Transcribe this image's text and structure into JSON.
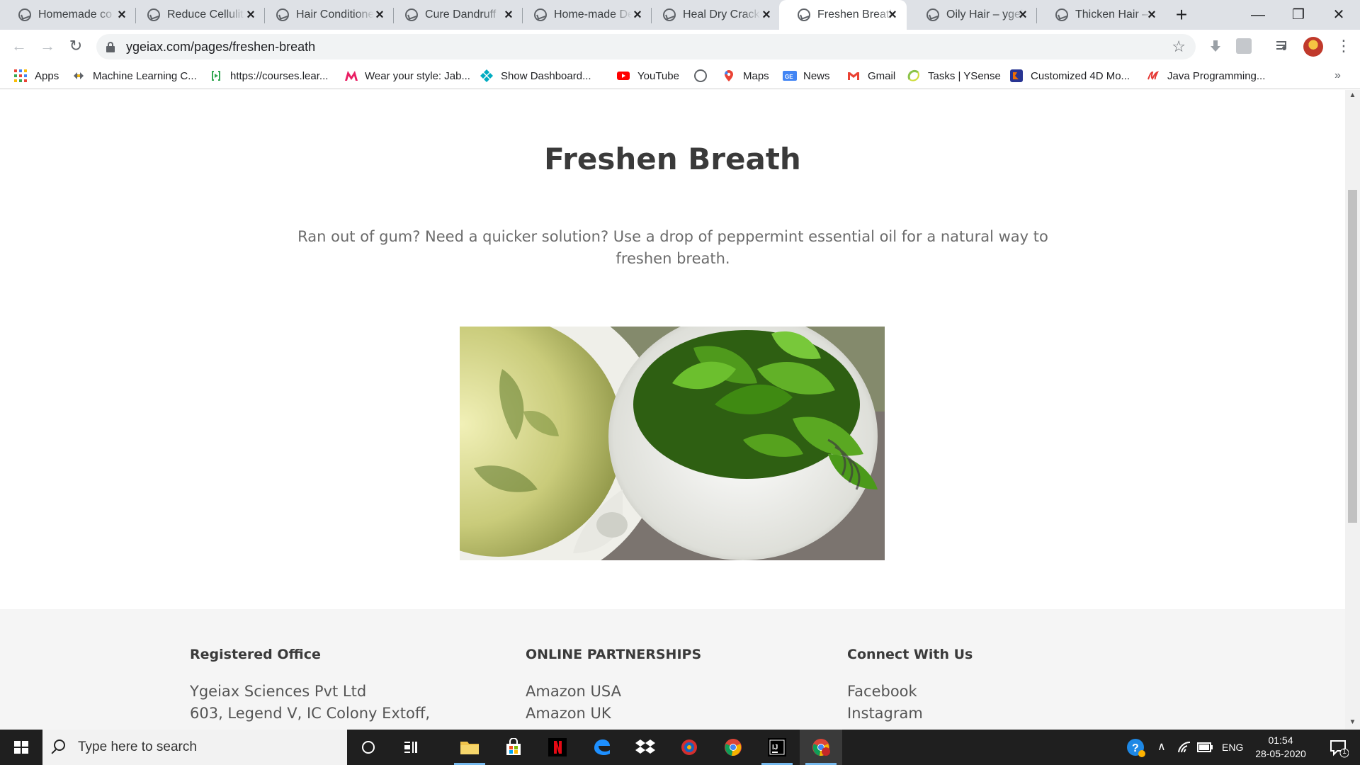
{
  "browser": {
    "tabs": [
      {
        "title": "Homemade co"
      },
      {
        "title": "Reduce Cellulit"
      },
      {
        "title": "Hair Conditione"
      },
      {
        "title": "Cure Dandruff"
      },
      {
        "title": "Home-made De"
      },
      {
        "title": "Heal Dry Crack"
      },
      {
        "title": "Freshen Breath",
        "active": true
      },
      {
        "title": "Oily Hair – ygei"
      },
      {
        "title": "Thicken Hair –"
      }
    ],
    "new_tab_glyph": "+",
    "url": "ygeiax.com/pages/freshen-breath",
    "window_controls": {
      "minimize": "—",
      "restore": "❐",
      "close": "✕"
    }
  },
  "bookmarks": [
    {
      "label": "Apps",
      "icon": "apps-grid-icon",
      "color": "#ea4335"
    },
    {
      "label": "Machine Learning C...",
      "icon": "ml-icon",
      "color": "#5f6368"
    },
    {
      "label": "https://courses.lear...",
      "icon": "courses-icon",
      "color": "#34a853"
    },
    {
      "label": "Wear your style: Jab...",
      "icon": "myntra-icon",
      "color": "#e91e63"
    },
    {
      "label": "Show Dashboard...",
      "icon": "dashboard-icon",
      "color": "#00acc1"
    },
    {
      "label": "YouTube",
      "icon": "youtube-icon",
      "color": "#ff0000"
    },
    {
      "label": "",
      "icon": "globe-icon",
      "color": "#5f6368"
    },
    {
      "label": "Maps",
      "icon": "maps-icon",
      "color": "#34a853"
    },
    {
      "label": "News",
      "icon": "news-icon",
      "color": "#4285f4"
    },
    {
      "label": "Gmail",
      "icon": "gmail-icon",
      "color": "#ea4335"
    },
    {
      "label": "Tasks | YSense",
      "icon": "ysense-icon",
      "color": "#8bc34a"
    },
    {
      "label": "Customized 4D Mo...",
      "icon": "4d-icon",
      "color": "#3f51b5"
    },
    {
      "label": "Java Programming...",
      "icon": "java-icon",
      "color": "#e53935"
    }
  ],
  "bookmarks_more": "»",
  "page": {
    "title": "Freshen Breath",
    "intro": "Ran out of gum? Need a quicker solution? Use a drop of peppermint essential oil for a natural way to freshen breath.",
    "footer": {
      "registered_office": {
        "heading": "Registered Office",
        "lines": [
          "Ygeiax Sciences Pvt Ltd",
          "603, Legend V, IC Colony Extoff,"
        ]
      },
      "online_partnerships": {
        "heading": "ONLINE PARTNERSHIPS",
        "lines": [
          "Amazon USA",
          "Amazon UK"
        ]
      },
      "connect": {
        "heading": "Connect With Us",
        "lines": [
          "Facebook",
          "Instagram"
        ]
      }
    }
  },
  "taskbar": {
    "search_placeholder": "Type here to search",
    "language": "ENG",
    "time": "01:54",
    "date": "28-05-2020",
    "notification_count": "1"
  }
}
